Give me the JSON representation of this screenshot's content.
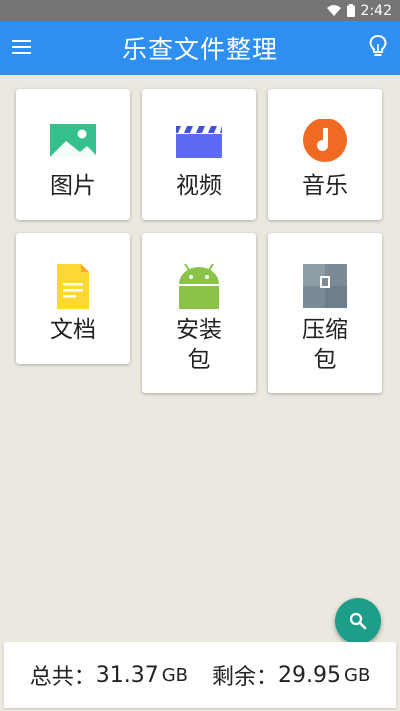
{
  "status_bar": {
    "time": "2:42",
    "wifi_icon": "wifi-icon",
    "battery_icon": "battery-icon"
  },
  "app_bar": {
    "title": "乐查文件整理",
    "menu_icon": "menu-icon",
    "tip_icon": "lightbulb-icon",
    "color": "#2f8ff0"
  },
  "categories": [
    {
      "label": "图片",
      "icon": "image-icon"
    },
    {
      "label": "视频",
      "icon": "video-clapper-icon"
    },
    {
      "label": "音乐",
      "icon": "music-note-icon"
    },
    {
      "label": "文档",
      "icon": "document-icon"
    },
    {
      "label": "安装包",
      "icon": "android-icon"
    },
    {
      "label": "压缩包",
      "icon": "archive-icon"
    }
  ],
  "storage": {
    "total_label": "总共：",
    "total_value": "31.37",
    "total_unit": "GB",
    "free_label": "剩余：",
    "free_value": "29.95",
    "free_unit": "GB"
  },
  "fab": {
    "icon": "search-icon",
    "color": "#1d9e8a"
  }
}
